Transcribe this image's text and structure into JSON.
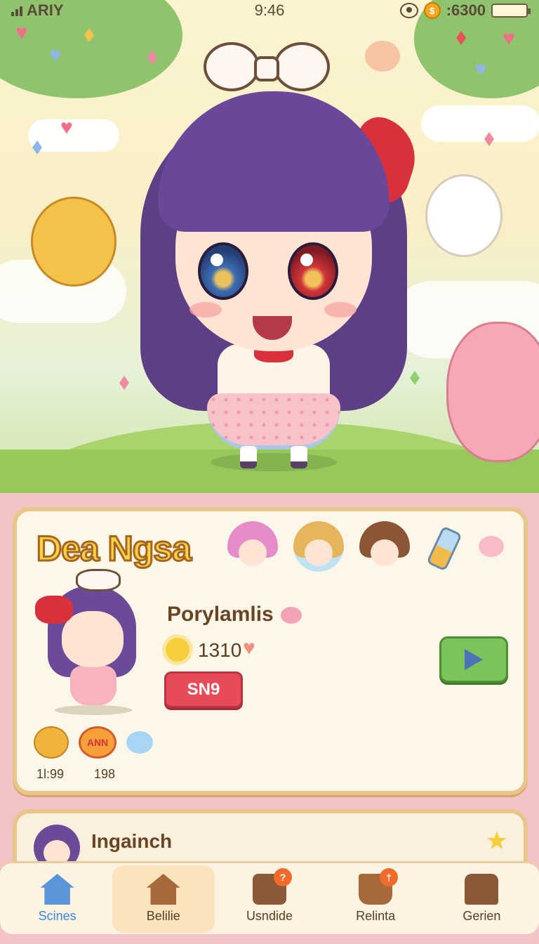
{
  "status": {
    "carrier": "ARIY",
    "time": "9:46",
    "coins": ":6300",
    "battery_level": 0.9
  },
  "scene": {
    "character": "girl-with-purple-hair",
    "pets": [
      "yellow-cat",
      "white-cat",
      "pink-cat"
    ]
  },
  "card": {
    "title": "Dea Ngsa",
    "player_name": "Porylamlis",
    "score": "1310",
    "badge_label": "SN9",
    "mini_labels": [
      "1l:99",
      "198"
    ],
    "mini_badge_text": "ANN"
  },
  "card2": {
    "name": "Ingainch"
  },
  "nav": {
    "items": [
      {
        "label": "Scines",
        "icon": "house-icon",
        "active": true
      },
      {
        "label": "Belilie",
        "icon": "house-icon",
        "active": false
      },
      {
        "label": "Usndide",
        "icon": "calendar-icon",
        "badge": "?"
      },
      {
        "label": "Relinta",
        "icon": "bucket-icon",
        "badge": "†"
      },
      {
        "label": "Gerien",
        "icon": "chest-icon"
      }
    ]
  },
  "colors": {
    "accent": "#e84b58",
    "title_fill": "#f6d24a",
    "play_green": "#7bc35a",
    "nav_active": "#3a86d8"
  }
}
